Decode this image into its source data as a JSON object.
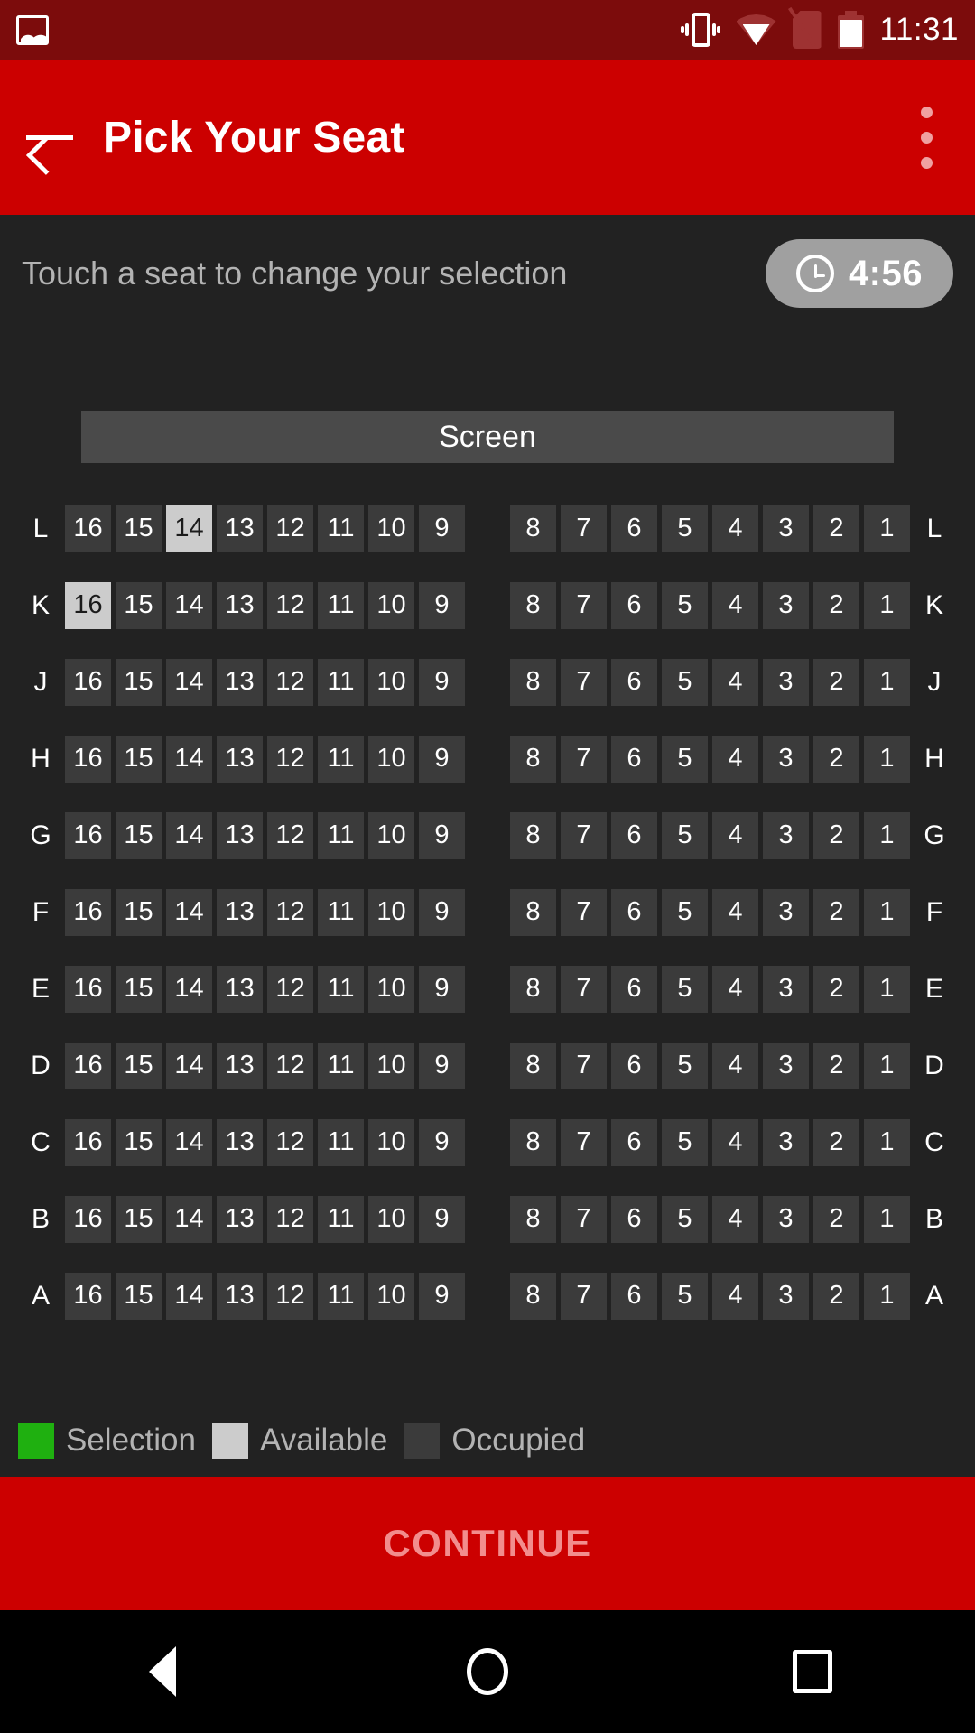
{
  "statusbar": {
    "time": "11:31",
    "icons": [
      "photo-icon",
      "vibrate-icon",
      "wifi-icon",
      "sim-off-icon",
      "battery-icon"
    ]
  },
  "appbar": {
    "back_icon": "arrow-left-icon",
    "title": "Pick Your Seat",
    "overflow_icon": "more-vertical-icon"
  },
  "instruction": {
    "text": "Touch a seat to change your selection",
    "timer_icon": "clock-icon",
    "timer_value": "4:56"
  },
  "seatmap": {
    "screen_label": "Screen",
    "left_seats": [
      "16",
      "15",
      "14",
      "13",
      "12",
      "11",
      "10",
      "9"
    ],
    "right_seats": [
      "8",
      "7",
      "6",
      "5",
      "4",
      "3",
      "2",
      "1"
    ],
    "rows": [
      {
        "label": "L",
        "left_states": [
          "occupied",
          "occupied",
          "available",
          "occupied",
          "occupied",
          "occupied",
          "occupied",
          "occupied"
        ],
        "right_states": [
          "occupied",
          "occupied",
          "occupied",
          "occupied",
          "occupied",
          "occupied",
          "occupied",
          "occupied"
        ]
      },
      {
        "label": "K",
        "left_states": [
          "available",
          "occupied",
          "occupied",
          "occupied",
          "occupied",
          "occupied",
          "occupied",
          "occupied"
        ],
        "right_states": [
          "occupied",
          "occupied",
          "occupied",
          "occupied",
          "occupied",
          "occupied",
          "occupied",
          "occupied"
        ]
      },
      {
        "label": "J",
        "left_states": [
          "occupied",
          "occupied",
          "occupied",
          "occupied",
          "occupied",
          "occupied",
          "occupied",
          "occupied"
        ],
        "right_states": [
          "occupied",
          "occupied",
          "occupied",
          "occupied",
          "occupied",
          "occupied",
          "occupied",
          "occupied"
        ]
      },
      {
        "label": "H",
        "left_states": [
          "occupied",
          "occupied",
          "occupied",
          "occupied",
          "occupied",
          "occupied",
          "occupied",
          "occupied"
        ],
        "right_states": [
          "occupied",
          "occupied",
          "occupied",
          "occupied",
          "occupied",
          "occupied",
          "occupied",
          "occupied"
        ]
      },
      {
        "label": "G",
        "left_states": [
          "occupied",
          "occupied",
          "occupied",
          "occupied",
          "occupied",
          "occupied",
          "occupied",
          "occupied"
        ],
        "right_states": [
          "occupied",
          "occupied",
          "occupied",
          "occupied",
          "occupied",
          "occupied",
          "occupied",
          "occupied"
        ]
      },
      {
        "label": "F",
        "left_states": [
          "occupied",
          "occupied",
          "occupied",
          "occupied",
          "occupied",
          "occupied",
          "occupied",
          "occupied"
        ],
        "right_states": [
          "occupied",
          "occupied",
          "occupied",
          "occupied",
          "occupied",
          "occupied",
          "occupied",
          "occupied"
        ]
      },
      {
        "label": "E",
        "left_states": [
          "occupied",
          "occupied",
          "occupied",
          "occupied",
          "occupied",
          "occupied",
          "occupied",
          "occupied"
        ],
        "right_states": [
          "occupied",
          "occupied",
          "occupied",
          "occupied",
          "occupied",
          "occupied",
          "occupied",
          "occupied"
        ]
      },
      {
        "label": "D",
        "left_states": [
          "occupied",
          "occupied",
          "occupied",
          "occupied",
          "occupied",
          "occupied",
          "occupied",
          "occupied"
        ],
        "right_states": [
          "occupied",
          "occupied",
          "occupied",
          "occupied",
          "occupied",
          "occupied",
          "occupied",
          "occupied"
        ]
      },
      {
        "label": "C",
        "left_states": [
          "occupied",
          "occupied",
          "occupied",
          "occupied",
          "occupied",
          "occupied",
          "occupied",
          "occupied"
        ],
        "right_states": [
          "occupied",
          "occupied",
          "occupied",
          "occupied",
          "occupied",
          "occupied",
          "occupied",
          "occupied"
        ]
      },
      {
        "label": "B",
        "left_states": [
          "occupied",
          "occupied",
          "occupied",
          "occupied",
          "occupied",
          "occupied",
          "occupied",
          "occupied"
        ],
        "right_states": [
          "occupied",
          "occupied",
          "occupied",
          "occupied",
          "occupied",
          "occupied",
          "occupied",
          "occupied"
        ]
      },
      {
        "label": "A",
        "left_states": [
          "occupied",
          "occupied",
          "occupied",
          "occupied",
          "occupied",
          "occupied",
          "occupied",
          "occupied"
        ],
        "right_states": [
          "occupied",
          "occupied",
          "occupied",
          "occupied",
          "occupied",
          "occupied",
          "occupied",
          "occupied"
        ]
      }
    ]
  },
  "legend": [
    {
      "label": "Selection",
      "color": "#1fb010"
    },
    {
      "label": "Available",
      "color": "#cccccc"
    },
    {
      "label": "Occupied",
      "color": "#3b3b3b"
    }
  ],
  "continue": {
    "label": "CONTINUE"
  },
  "navbar": {
    "back_icon": "nav-back-icon",
    "home_icon": "nav-home-icon",
    "recents_icon": "nav-recents-icon"
  },
  "colors": {
    "status_bar": "#7c0c0c",
    "app_bar": "#cc0000",
    "background": "#222222",
    "seat_occupied": "#3b3b3b",
    "seat_available": "#cccccc",
    "seat_selection": "#1fb010",
    "continue_bg": "#cc0000",
    "continue_text": "#f28d8d"
  }
}
